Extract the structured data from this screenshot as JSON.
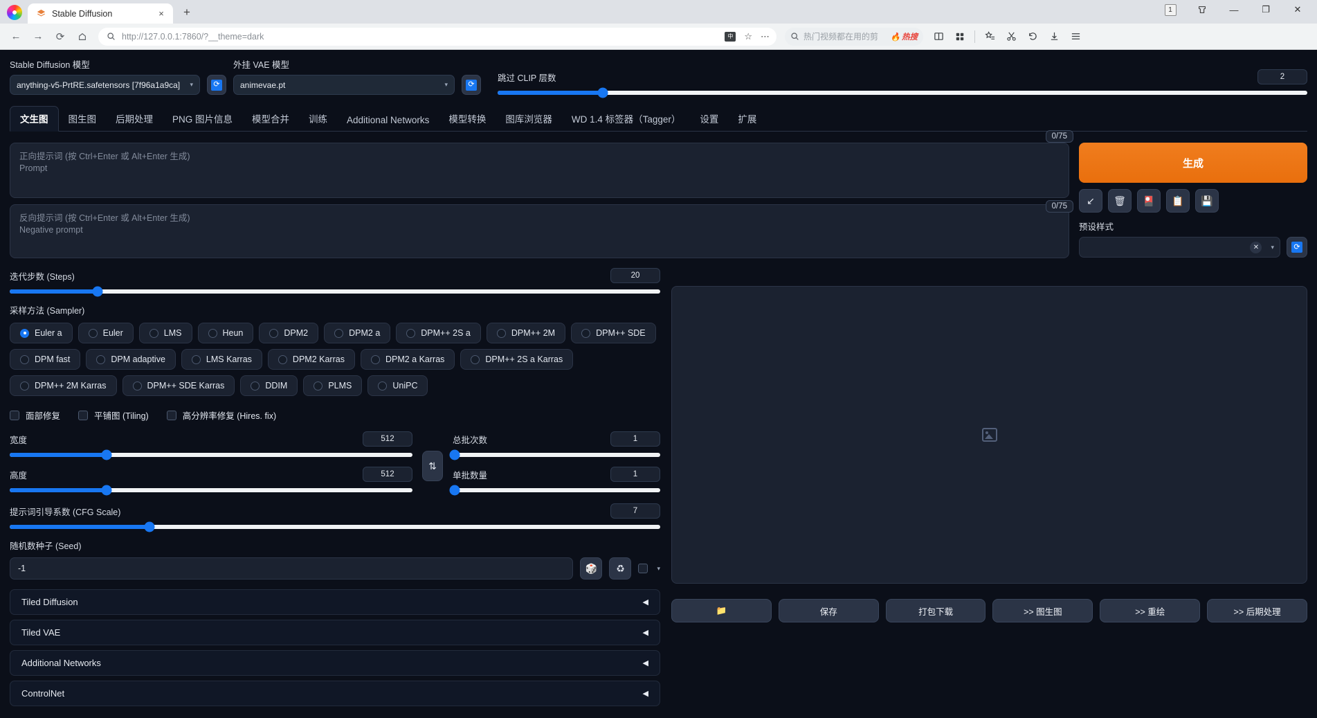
{
  "browser": {
    "tab": {
      "title": "Stable Diffusion",
      "favicon_icon": "layers-icon",
      "close_icon": "×",
      "new_tab_icon": "+"
    },
    "window": {
      "profile_badge": "1",
      "collections_icon": "collections-icon",
      "minimize_icon": "—",
      "maximize_icon": "❐",
      "close_icon": "✕"
    },
    "nav": {
      "back_icon": "←",
      "forward_icon": "→",
      "reload_icon": "⟳",
      "home_icon": "⌂"
    },
    "omnibox": {
      "search_icon": "search-icon",
      "url": "http://127.0.0.1:7860/?__theme=dark",
      "translate_icon": "translate-icon",
      "favorite_icon": "☆",
      "more_icon": "⋯"
    },
    "searchbox": {
      "search_icon": "search-icon",
      "placeholder": "热门视频都在用的剪",
      "hot_label": "热搜",
      "flame_icon": "🔥"
    },
    "toolbar_icons": [
      "reading-mode-icon",
      "apps-grid-icon",
      "collections-icon",
      "screenshot-icon",
      "history-icon",
      "downloads-icon",
      "menu-icon"
    ]
  },
  "topbar": {
    "sd_model": {
      "label": "Stable Diffusion 模型",
      "value": "anything-v5-PrtRE.safetensors [7f96a1a9ca]",
      "caret": "▾"
    },
    "sd_refresh_icon": "refresh-icon",
    "vae_model": {
      "label": "外挂 VAE 模型",
      "value": "animevae.pt",
      "caret": "▾"
    },
    "vae_refresh_icon": "refresh-icon",
    "clip_skip": {
      "label": "跳过 CLIP 层数",
      "value": "2",
      "fill_pct": 13
    }
  },
  "tabs": [
    {
      "label": "文生图",
      "active": true
    },
    {
      "label": "图生图",
      "active": false
    },
    {
      "label": "后期处理",
      "active": false
    },
    {
      "label": "PNG 图片信息",
      "active": false
    },
    {
      "label": "模型合并",
      "active": false
    },
    {
      "label": "训练",
      "active": false
    },
    {
      "label": "Additional Networks",
      "active": false
    },
    {
      "label": "模型转换",
      "active": false
    },
    {
      "label": "图库浏览器",
      "active": false
    },
    {
      "label": "WD 1.4 标签器（Tagger）",
      "active": false
    },
    {
      "label": "设置",
      "active": false
    },
    {
      "label": "扩展",
      "active": false
    }
  ],
  "prompt": {
    "positive": {
      "placeholder_line1": "正向提示词 (按 Ctrl+Enter 或 Alt+Enter 生成)",
      "placeholder_line2": "Prompt",
      "value": "",
      "counter": "0/75"
    },
    "negative": {
      "placeholder_line1": "反向提示词 (按 Ctrl+Enter 或 Alt+Enter 生成)",
      "placeholder_line2": "Negative prompt",
      "value": "",
      "counter": "0/75"
    }
  },
  "generate": {
    "button_label": "生成",
    "accent_color": "#ea7317",
    "icon_buttons": [
      {
        "name": "arrow-down-left-icon",
        "glyph": "↙"
      },
      {
        "name": "trash-icon",
        "glyph": "🗑"
      },
      {
        "name": "extra-networks-icon",
        "glyph": "🎴"
      },
      {
        "name": "clipboard-icon",
        "glyph": "📋"
      },
      {
        "name": "save-style-icon",
        "glyph": "💾"
      }
    ],
    "styles": {
      "label": "预设样式",
      "value": "",
      "clear_icon": "✕",
      "caret": "▾",
      "refresh_icon": "refresh-icon"
    }
  },
  "params": {
    "steps": {
      "label": "迭代步数 (Steps)",
      "value": "20",
      "fill_pct": 13.5
    },
    "sampler": {
      "label": "采样方法 (Sampler)",
      "selected": "Euler a",
      "options": [
        "Euler a",
        "Euler",
        "LMS",
        "Heun",
        "DPM2",
        "DPM2 a",
        "DPM++ 2S a",
        "DPM++ 2M",
        "DPM++ SDE",
        "DPM fast",
        "DPM adaptive",
        "LMS Karras",
        "DPM2 Karras",
        "DPM2 a Karras",
        "DPM++ 2S a Karras",
        "DPM++ 2M Karras",
        "DPM++ SDE Karras",
        "DDIM",
        "PLMS",
        "UniPC"
      ]
    },
    "checkboxes": [
      {
        "label": "面部修复",
        "checked": false
      },
      {
        "label": "平铺图 (Tiling)",
        "checked": false
      },
      {
        "label": "高分辨率修复 (Hires. fix)",
        "checked": false
      }
    ],
    "width": {
      "label": "宽度",
      "value": "512",
      "fill_pct": 24
    },
    "height": {
      "label": "高度",
      "value": "512",
      "fill_pct": 24
    },
    "swap_icon": "swap-vertical-icon",
    "batch_count": {
      "label": "总批次数",
      "value": "1",
      "fill_pct": 0
    },
    "batch_size": {
      "label": "单批数量",
      "value": "1",
      "fill_pct": 0
    },
    "cfg_scale": {
      "label": "提示词引导系数 (CFG Scale)",
      "value": "7",
      "fill_pct": 21.5
    },
    "seed": {
      "label": "随机数种子 (Seed)",
      "value": "-1",
      "dice_icon": "dice-icon",
      "recycle_icon": "recycle-icon",
      "extra_checkbox_checked": false,
      "expand_caret": "▾"
    }
  },
  "accordions": [
    {
      "label": "Tiled Diffusion",
      "arrow": "◀"
    },
    {
      "label": "Tiled VAE",
      "arrow": "◀"
    },
    {
      "label": "Additional Networks",
      "arrow": "◀"
    },
    {
      "label": "ControlNet",
      "arrow": "◀"
    }
  ],
  "output": {
    "placeholder_icon": "image-placeholder-icon",
    "buttons": [
      {
        "label": "",
        "icon": "folder-icon",
        "glyph": "📁"
      },
      {
        "label": "保存",
        "icon": "",
        "glyph": ""
      },
      {
        "label": "打包下载",
        "icon": "",
        "glyph": ""
      },
      {
        "label": ">> 图生图",
        "icon": "",
        "glyph": ""
      },
      {
        "label": ">> 重绘",
        "icon": "",
        "glyph": ""
      },
      {
        "label": ">> 后期处理",
        "icon": "",
        "glyph": ""
      }
    ]
  }
}
